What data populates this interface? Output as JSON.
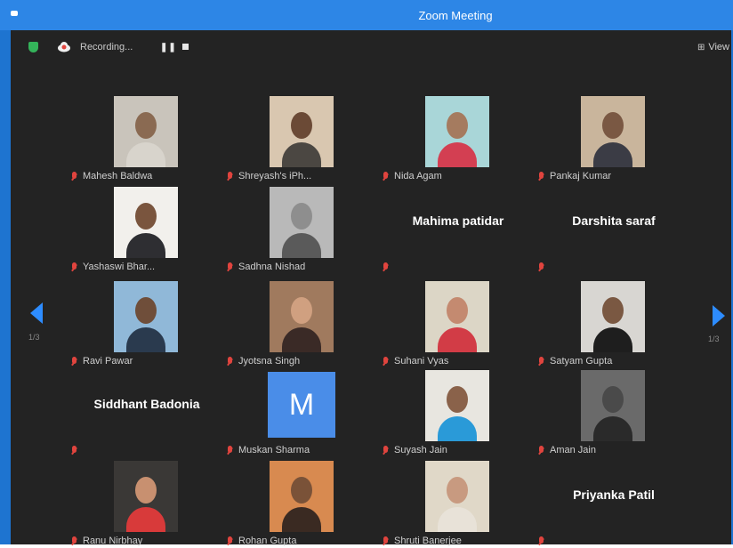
{
  "window": {
    "title": "Zoom Meeting"
  },
  "toolbar": {
    "recording_label": "Recording...",
    "pause_label": "❚❚",
    "view_label": "View",
    "view_icon": "⊞"
  },
  "pager": {
    "left": "1/3",
    "right": "1/3"
  },
  "colors": {
    "titlebar": "#2d86e6",
    "background": "#232323",
    "mic_muted": "#e0443e",
    "shield": "#34b35a",
    "nav_arrow": "#2d8cff",
    "avatar_letter_bg": "#4a8de8"
  },
  "participants": [
    {
      "name": "Mahesh Baldwa",
      "has_video": true,
      "bg": "#c9c4bb",
      "skin": "#8a6a52",
      "shirt": "#d8d4cc"
    },
    {
      "name": "Shreyash's iPh...",
      "has_video": true,
      "bg": "#d9c7b0",
      "skin": "#6b4a36",
      "shirt": "#4b4742"
    },
    {
      "name": "Nida Agam",
      "has_video": true,
      "bg": "#a9d6d8",
      "skin": "#a57b5f",
      "shirt": "#d33f52"
    },
    {
      "name": "Pankaj Kumar",
      "has_video": true,
      "bg": "#c9b59c",
      "skin": "#7a5843",
      "shirt": "#3b3c45"
    },
    {
      "name": "Yashaswi Bhar...",
      "has_video": true,
      "bg": "#f2f0ec",
      "skin": "#7a553e",
      "shirt": "#2e2e32"
    },
    {
      "name": "Sadhna Nishad",
      "has_video": true,
      "bg": "#b9b9b9",
      "skin": "#8e8e8e",
      "shirt": "#5a5a5a"
    },
    {
      "name": "Mahima patidar",
      "has_video": false
    },
    {
      "name": "Darshita saraf",
      "has_video": false
    },
    {
      "name": "Ravi Pawar",
      "has_video": true,
      "bg": "#90b8d8",
      "skin": "#6f4e3a",
      "shirt": "#2a3a4e"
    },
    {
      "name": "Jyotsna Singh",
      "has_video": true,
      "bg": "#a07a5e",
      "skin": "#d0a080",
      "shirt": "#3a2a26"
    },
    {
      "name": "Suhani Vyas",
      "has_video": true,
      "bg": "#dcd6c6",
      "skin": "#c48a70",
      "shirt": "#d23c46"
    },
    {
      "name": "Satyam Gupta",
      "has_video": true,
      "bg": "#d8d6d2",
      "skin": "#7a5842",
      "shirt": "#1e1e1e"
    },
    {
      "name": "Siddhant Badonia",
      "has_video": false
    },
    {
      "name": "Muskan Sharma",
      "has_video": false,
      "letter": "M"
    },
    {
      "name": "Suyash Jain",
      "has_video": true,
      "bg": "#e8e6e0",
      "skin": "#8a624a",
      "shirt": "#2a9ad8"
    },
    {
      "name": "Aman Jain",
      "has_video": true,
      "bg": "#6a6a6a",
      "skin": "#4a4a4a",
      "shirt": "#2a2a2a"
    },
    {
      "name": "Ranu Nirbhay",
      "has_video": true,
      "bg": "#3a3836",
      "skin": "#c89070",
      "shirt": "#d83a3a"
    },
    {
      "name": "Rohan Gupta",
      "has_video": true,
      "bg": "#d88a50",
      "skin": "#7a5238",
      "shirt": "#3a2a22"
    },
    {
      "name": "Shruti Banerjee",
      "has_video": true,
      "bg": "#e0d8c8",
      "skin": "#c89a80",
      "shirt": "#e8e2d8"
    },
    {
      "name": "Priyanka Patil",
      "has_video": false
    }
  ]
}
